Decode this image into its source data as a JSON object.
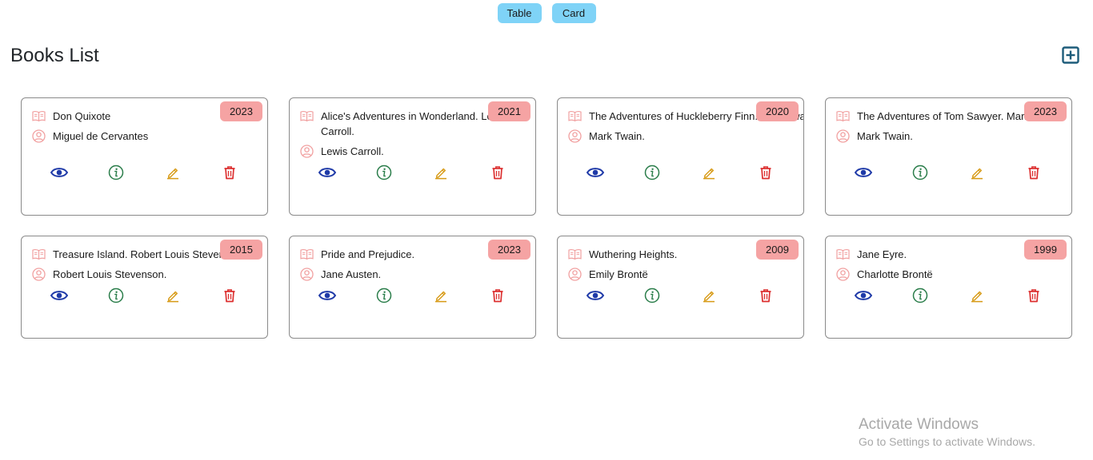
{
  "view_toggle": {
    "table_label": "Table",
    "card_label": "Card"
  },
  "page": {
    "title": "Books List",
    "add_icon": "plus-square-icon"
  },
  "colors": {
    "toggle_bg": "#7fd3f7",
    "badge_bg": "#f5a3a3",
    "view_icon": "#1f3aa8",
    "info_icon": "#2a7d4a",
    "edit_icon": "#d79a15",
    "delete_icon": "#dc2f2f",
    "meta_icon": "#f1a0a0",
    "add_icon": "#1d5c7a"
  },
  "books": [
    {
      "title": "Don Quixote",
      "author": "Miguel de Cervantes",
      "year": "2023"
    },
    {
      "title": "Alice's Adventures in Wonderland. Lewis Carroll.",
      "author": "Lewis Carroll.",
      "year": "2021"
    },
    {
      "title": "The Adventures of Huckleberry Finn. Mark Twain.",
      "author": "Mark Twain.",
      "year": "2020"
    },
    {
      "title": "The Adventures of Tom Sawyer. Mark Twain.",
      "author": "Mark Twain.",
      "year": "2023"
    },
    {
      "title": "Treasure Island. Robert Louis Stevenson.",
      "author": "Robert Louis Stevenson.",
      "year": "2015"
    },
    {
      "title": "Pride and Prejudice.",
      "author": "Jane Austen.",
      "year": "2023"
    },
    {
      "title": "Wuthering Heights.",
      "author": "Emily Brontë",
      "year": "2009"
    },
    {
      "title": "Jane Eyre.",
      "author": "Charlotte Brontë",
      "year": "1999"
    }
  ],
  "card_icons": {
    "title": "book-open-icon",
    "author": "person-circle-icon",
    "view": "eye-icon",
    "info": "info-circle-icon",
    "edit": "pencil-icon",
    "delete": "trash-icon"
  },
  "watermark": {
    "line1": "Activate Windows",
    "line2": "Go to Settings to activate Windows."
  }
}
